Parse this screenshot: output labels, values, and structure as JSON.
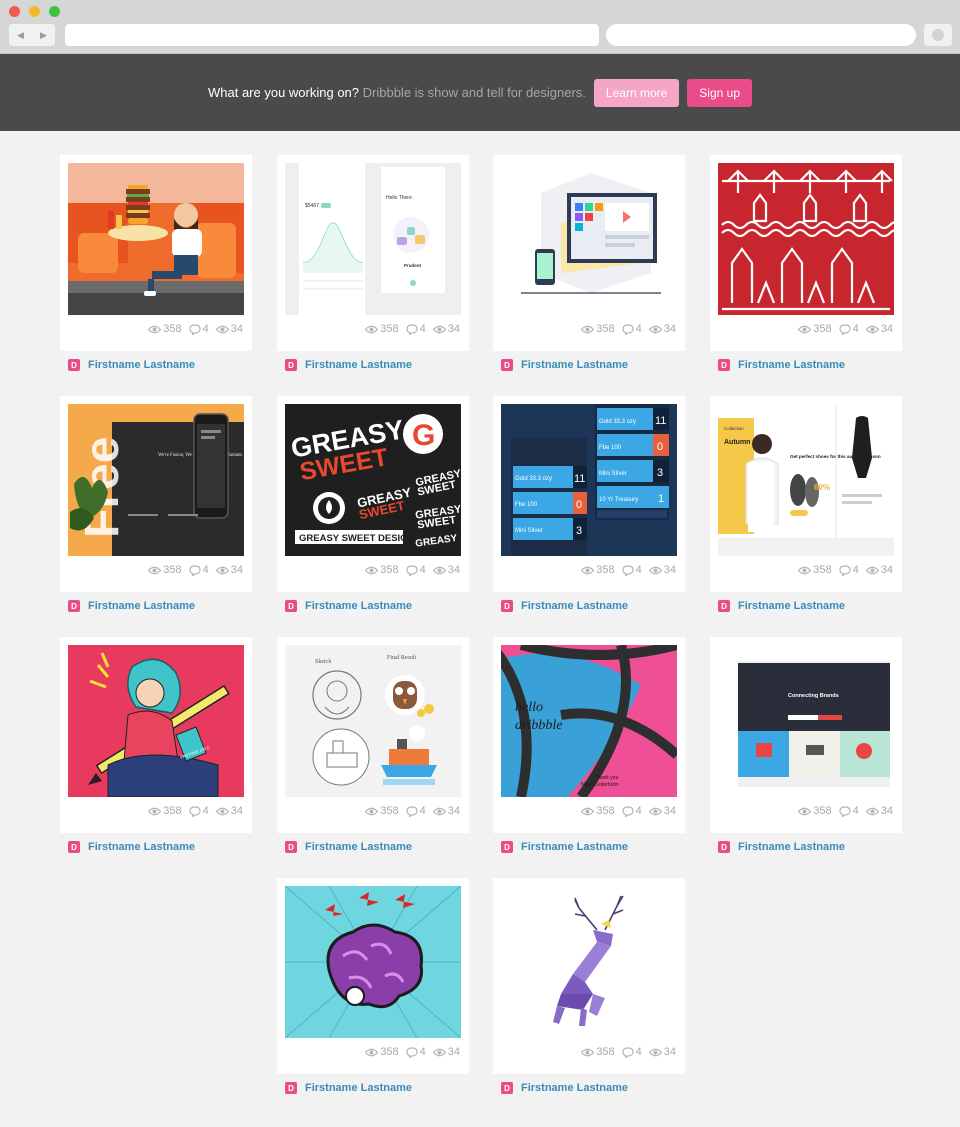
{
  "banner": {
    "question": "What are you working on?",
    "tagline": "Dribbble is show and tell for designers.",
    "learn_more": "Learn more",
    "sign_up": "Sign up"
  },
  "shots": [
    {
      "views": "358",
      "comments": "4",
      "likes": "34",
      "author": "Firstname Lastname"
    },
    {
      "views": "358",
      "comments": "4",
      "likes": "34",
      "author": "Firstname Lastname"
    },
    {
      "views": "358",
      "comments": "4",
      "likes": "34",
      "author": "Firstname Lastname"
    },
    {
      "views": "358",
      "comments": "4",
      "likes": "34",
      "author": "Firstname Lastname"
    },
    {
      "views": "358",
      "comments": "4",
      "likes": "34",
      "author": "Firstname Lastname"
    },
    {
      "views": "358",
      "comments": "4",
      "likes": "34",
      "author": "Firstname Lastname"
    },
    {
      "views": "358",
      "comments": "4",
      "likes": "34",
      "author": "Firstname Lastname"
    },
    {
      "views": "358",
      "comments": "4",
      "likes": "34",
      "author": "Firstname Lastname"
    },
    {
      "views": "358",
      "comments": "4",
      "likes": "34",
      "author": "Firstname Lastname"
    },
    {
      "views": "358",
      "comments": "4",
      "likes": "34",
      "author": "Firstname Lastname"
    },
    {
      "views": "358",
      "comments": "4",
      "likes": "34",
      "author": "Firstname Lastname"
    },
    {
      "views": "358",
      "comments": "4",
      "likes": "34",
      "author": "Firstname Lastname"
    },
    {
      "views": "358",
      "comments": "4",
      "likes": "34",
      "author": "Firstname Lastname"
    },
    {
      "views": "358",
      "comments": "4",
      "likes": "34",
      "author": "Firstname Lastname"
    }
  ],
  "thumb_text": {
    "s2_title": "Hello There.",
    "s2_value": "$5467",
    "s2_label": "Prudent",
    "s5_word": "Free",
    "s5_headline": "We're Fusion, We Make Things for Humans",
    "s6_word1": "GREASY",
    "s6_word2": "SWEET",
    "s6_letter": "G",
    "s6_design": "GREASY SWEET DESIGN",
    "s7_items": [
      "Gold 33.3 ozy",
      "Fbe 100",
      "Mini Silver",
      "10 Yr Treasury"
    ],
    "s7_numbers": [
      "11",
      "0",
      "3",
      "1"
    ],
    "s8_collection": "Collection",
    "s8_season": "Autumn 2016",
    "s8_percent": "60%",
    "s8_blurb": "Get perfect shoes for this autumn season",
    "s9_tag": "PANTONE 136 C",
    "s10_label1": "Sketch",
    "s10_label2": "Final Result",
    "s11_hello": "hello",
    "s11_brand": "dribbble",
    "s11_thanks": "Thank you",
    "s11_name": "Noah Cederholm",
    "s12_title": "Connecting Brands"
  },
  "colors": {
    "accent": "#ea4c89",
    "author_link": "#3a8bbb",
    "banner_bg": "#4a4a4a"
  }
}
